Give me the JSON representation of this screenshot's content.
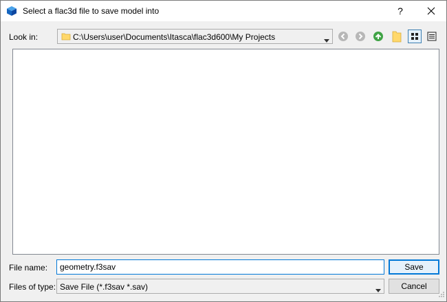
{
  "window": {
    "title": "Select a flac3d file to save model into",
    "help_glyph": "?",
    "app_icon": "flac3d-cube-icon"
  },
  "look_in": {
    "label": "Look in:",
    "path": "C:\\Users\\user\\Documents\\Itasca\\flac3d600\\My Projects"
  },
  "toolbar": {
    "icons": [
      "back-arrow-icon",
      "forward-arrow-icon",
      "up-folder-icon",
      "new-folder-icon",
      "list-view-icon",
      "detail-view-icon"
    ],
    "active_view": "list-view-icon"
  },
  "file_name": {
    "label": "File name:",
    "value": "geometry.f3sav"
  },
  "file_type": {
    "label": "Files of type:",
    "value": "Save File (*.f3sav *.sav)"
  },
  "buttons": {
    "save": "Save",
    "cancel": "Cancel"
  },
  "colors": {
    "accent": "#0078d7",
    "up_arrow": "#3fa345",
    "folder": "#ffd86b"
  }
}
